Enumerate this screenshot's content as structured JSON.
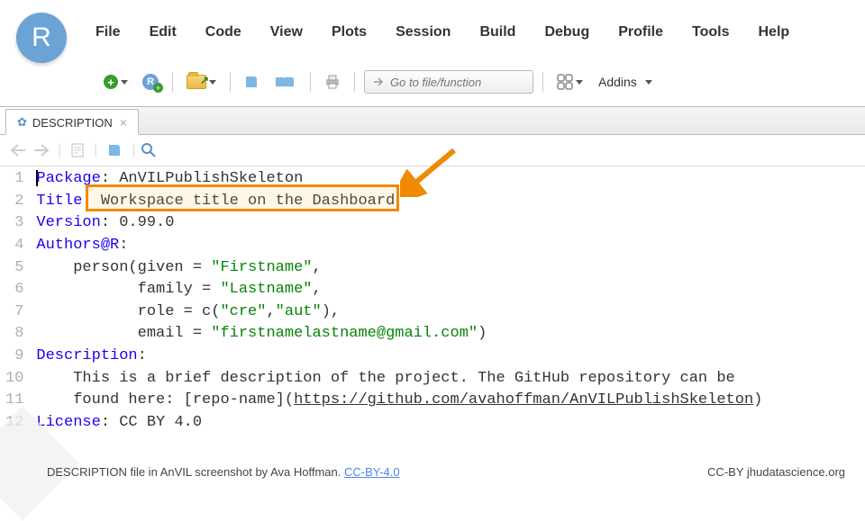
{
  "menu": [
    "File",
    "Edit",
    "Code",
    "View",
    "Plots",
    "Session",
    "Build",
    "Debug",
    "Profile",
    "Tools",
    "Help"
  ],
  "goto_placeholder": "Go to file/function",
  "addins_label": "Addins",
  "tab_name": "DESCRIPTION",
  "code": {
    "l1_key": "Package",
    "l1_val": ": AnVILPublishSkeleton",
    "l2_key": "Title",
    "l2_pre": ": ",
    "l2_val": "Workspace title on the Dashboard",
    "l3_key": "Version",
    "l3_val": ": 0.99.0",
    "l4_key": "Authors@R",
    "l4_val": ":",
    "l5a": "    person(given = ",
    "l5s": "\"Firstname\"",
    "l5b": ",",
    "l6a": "           family = ",
    "l6s": "\"Lastname\"",
    "l6b": ",",
    "l7a": "           role = c(",
    "l7s1": "\"cre\"",
    "l7m": ",",
    "l7s2": "\"aut\"",
    "l7b": "),",
    "l8a": "           email = ",
    "l8s": "\"firstnamelastname@gmail.com\"",
    "l8b": ")",
    "l9_key": "Description",
    "l9_val": ":",
    "l10": "    This is a brief description of the project. The GitHub repository can be",
    "l11a": "    found here: [repo-name](",
    "l11u": "https://github.com/avahoffman/AnVILPublishSkeleton",
    "l11b": ")",
    "l12_key": "License",
    "l12_val": ": CC BY 4.0"
  },
  "line_count": 12,
  "footer_left": "DESCRIPTION file  in AnVIL screenshot by Ava Hoffman.  ",
  "footer_link": "CC-BY-4.0",
  "footer_right": "CC-BY  jhudatascience.org"
}
